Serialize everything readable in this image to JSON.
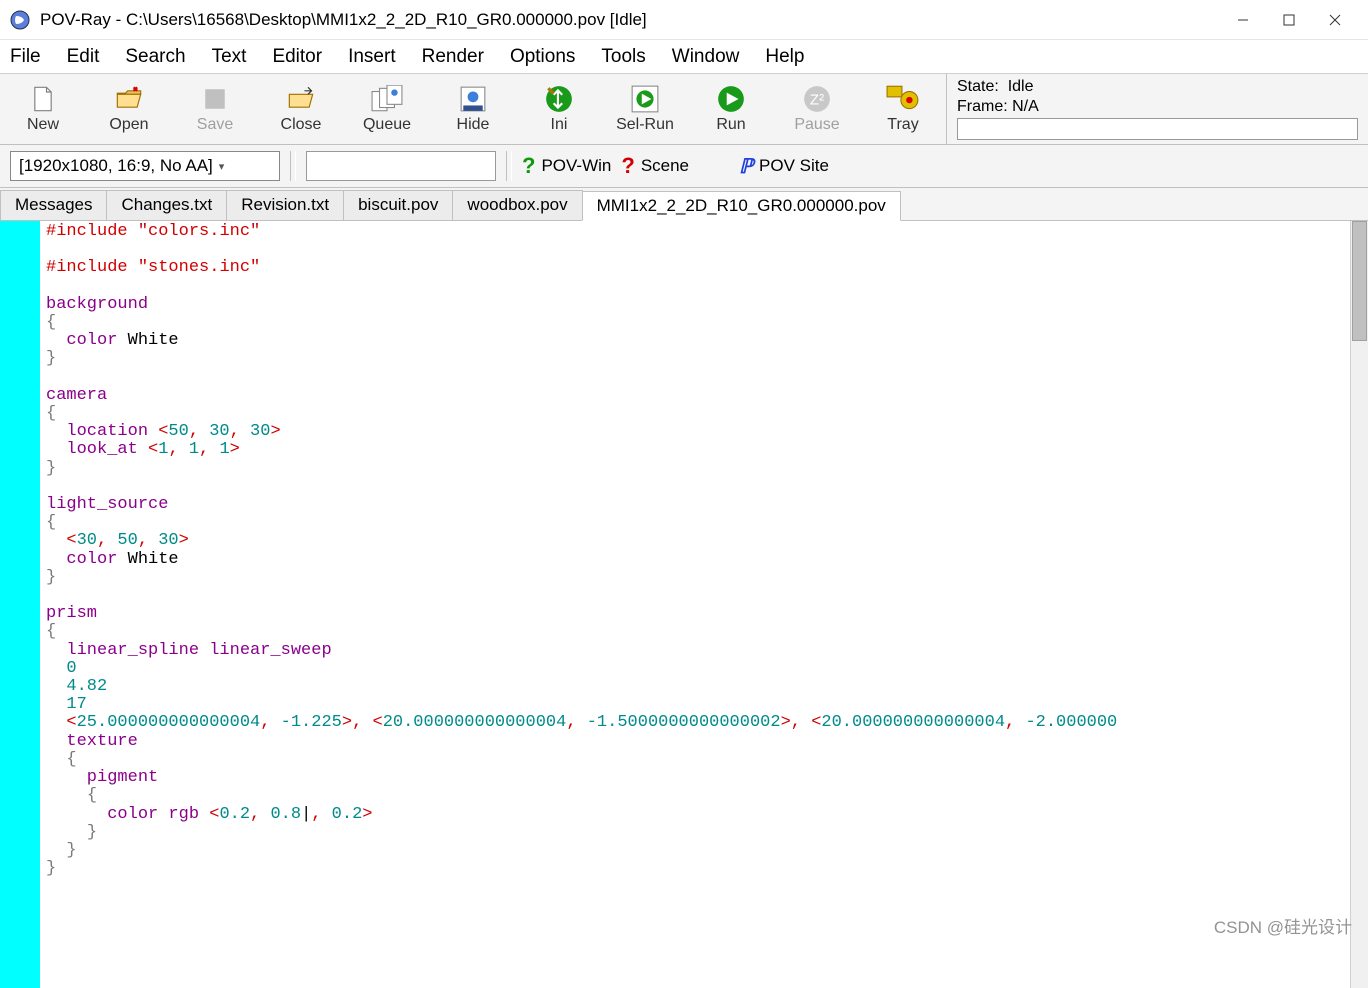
{
  "title": "POV-Ray - C:\\Users\\16568\\Desktop\\MMI1x2_2_2D_R10_GR0.000000.pov [Idle]",
  "menu": [
    "File",
    "Edit",
    "Search",
    "Text",
    "Editor",
    "Insert",
    "Render",
    "Options",
    "Tools",
    "Window",
    "Help"
  ],
  "toolbar": [
    {
      "label": "New",
      "icon": "file",
      "enabled": true
    },
    {
      "label": "Open",
      "icon": "folder",
      "enabled": true
    },
    {
      "label": "Save",
      "icon": "save",
      "enabled": false
    },
    {
      "label": "Close",
      "icon": "folder-up",
      "enabled": true
    },
    {
      "label": "Queue",
      "icon": "queue",
      "enabled": true
    },
    {
      "label": "Hide",
      "icon": "hide",
      "enabled": true
    },
    {
      "label": "Ini",
      "icon": "ini",
      "enabled": true
    },
    {
      "label": "Sel-Run",
      "icon": "sel-run",
      "enabled": true
    },
    {
      "label": "Run",
      "icon": "run",
      "enabled": true
    },
    {
      "label": "Pause",
      "icon": "pause",
      "enabled": false
    },
    {
      "label": "Tray",
      "icon": "tray",
      "enabled": true
    }
  ],
  "status": {
    "stateLabel": "State:",
    "stateValue": "Idle",
    "frameLabel": "Frame:",
    "frameValue": "N/A"
  },
  "resolution": "[1920x1080, 16:9, No AA]",
  "links": [
    {
      "label": "POV-Win",
      "icon": "?",
      "color": "#0a0"
    },
    {
      "label": "Scene",
      "icon": "?",
      "color": "#d00000"
    },
    {
      "label": "POV Site",
      "icon": "bolt",
      "color": "#00f"
    }
  ],
  "tabs": [
    "Messages",
    "Changes.txt",
    "Revision.txt",
    "biscuit.pov",
    "woodbox.pov",
    "MMI1x2_2_2D_R10_GR0.000000.pov"
  ],
  "activeTab": 5,
  "code": {
    "inc1": "#include ",
    "str1": "\"colors.inc\"",
    "inc2": "#include ",
    "str2": "\"stones.inc\"",
    "bg": "background",
    "lb": "{",
    "rb": "}",
    "colorKw": "color",
    "white": "White",
    "camera": "camera",
    "location": "  location ",
    "loc_l": "<",
    "n50": "50",
    ", ": "",
    "n30a": "30",
    "n30b": "30",
    ">": "",
    "lookat": "  look_at ",
    "n1a": "1",
    "n1b": "1",
    "n1c": "1",
    "light": "light_source",
    "ls_nums": "<30, 50, 30>",
    "prism": "prism",
    "linear": "  linear_spline linear_sweep",
    "z0": "0",
    "z482": "4.82",
    "z17": "17",
    "coords": "  <25.000000000000004, -1.225>, <20.000000000000004, -1.5000000000000002>, <20.000000000000004, -2.000000",
    "texture": "  texture",
    "pigment": "    pigment",
    "colrgb": "      color rgb ",
    "rgb": "<0.2, 0.8, 0.2>",
    "rgbA": "0.2",
    "rgbB": "0.8",
    "rgbC": "0.2"
  },
  "watermark": "CSDN @硅光设计"
}
